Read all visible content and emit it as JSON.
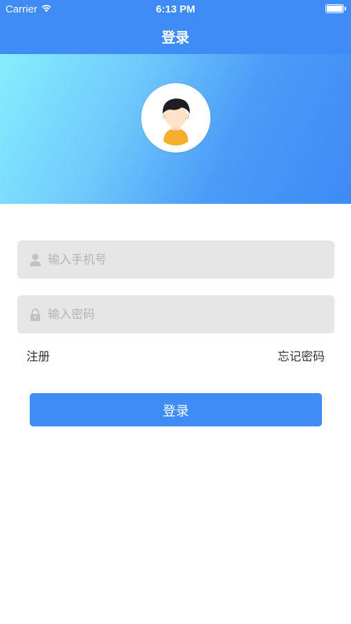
{
  "status_bar": {
    "carrier": "Carrier",
    "time": "6:13 PM"
  },
  "nav": {
    "title": "登录"
  },
  "form": {
    "phone_placeholder": "输入手机号",
    "password_placeholder": "输入密码",
    "register_label": "注册",
    "forgot_label": "忘记密码",
    "login_label": "登录"
  },
  "colors": {
    "primary": "#3f8cf7",
    "gradient_start": "#86eefe",
    "field_background": "#e6e6e6"
  },
  "icons": {
    "phone_field": "user-icon",
    "password_field": "lock-icon",
    "wifi": "wifi-icon",
    "battery": "battery-icon"
  }
}
